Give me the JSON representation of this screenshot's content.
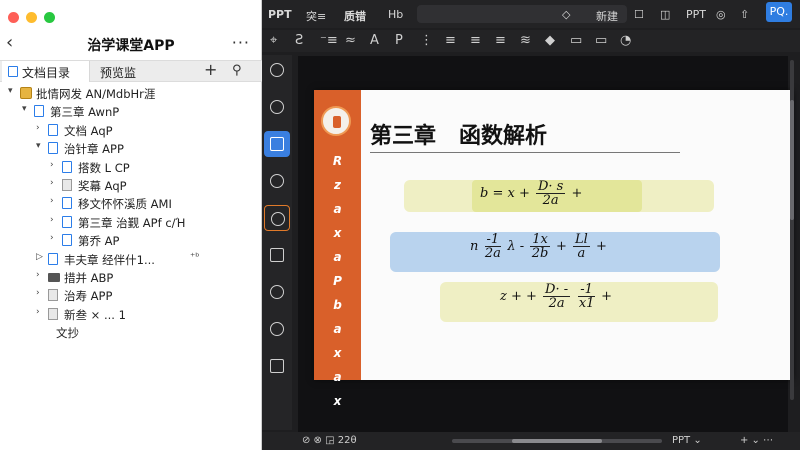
{
  "left_panel": {
    "title": "治学课堂APP",
    "back_icon": "chevron-left-icon",
    "more_label": "···",
    "tabs": [
      {
        "label": "文档目录",
        "icon": "document-icon"
      },
      {
        "label": "预览监"
      }
    ],
    "add_label": "+",
    "tree": [
      {
        "label": "批情网发 AN/MdbHr涯",
        "level": 0,
        "chev": "▾",
        "icon": "root"
      },
      {
        "label": "第三章 AwnP",
        "level": 1,
        "chev": "▾",
        "icon": "doc"
      },
      {
        "label": "文档 AqP",
        "level": 2,
        "chev": "›",
        "icon": "doc"
      },
      {
        "label": "治针章 APP",
        "level": 2,
        "chev": "▾",
        "icon": "doc"
      },
      {
        "label": "搭数 L CP",
        "level": 3,
        "chev": "›",
        "icon": "doc"
      },
      {
        "label": "奖幕 AqP",
        "level": 3,
        "chev": "›",
        "icon": "book"
      },
      {
        "label": "移文怀怀溪质 AMI",
        "level": 3,
        "chev": "›",
        "icon": "doc"
      },
      {
        "label": "第三章  治觐 APf ᴄ/Ή",
        "level": 3,
        "chev": "›",
        "icon": "doc"
      },
      {
        "label": "第乔 AP",
        "level": 3,
        "chev": "›",
        "icon": "doc"
      },
      {
        "label": "丰夫章  经伴什1...",
        "level": 2,
        "chev": "▷",
        "icon": "doc",
        "extra": "⁺ᵇ"
      },
      {
        "label": "措并 ABP",
        "level": 2,
        "chev": "›",
        "icon": "folder"
      },
      {
        "label": "治寿 APP",
        "level": 2,
        "chev": "›",
        "icon": "book"
      },
      {
        "label": "新叁  × ...  1",
        "level": 2,
        "chev": "›",
        "icon": "book"
      },
      {
        "label": "文抄",
        "level": 2,
        "chev": "",
        "icon": "none"
      }
    ]
  },
  "editor": {
    "toolbar1": {
      "app": "PPT",
      "items": [
        "突≡",
        "质错",
        "Hb"
      ],
      "right_items": [
        "◇",
        "新建",
        "☐",
        "◫",
        "PPT",
        "◎",
        "⇧"
      ],
      "account_badge": "PQ."
    },
    "toolbar2": [
      "⌖",
      "Ƨ",
      "⁻≡",
      "≈",
      "A",
      "P",
      "⋮",
      "≡",
      "≡",
      "≡",
      "≋",
      "◆",
      "▭",
      "▭",
      "◔"
    ],
    "rail_icons": [
      {
        "name": "chart-icon",
        "active": false
      },
      {
        "name": "search-icon",
        "active": false
      },
      {
        "name": "search-icon-active",
        "active": true
      },
      {
        "name": "layers-icon",
        "active": false
      },
      {
        "name": "database-icon",
        "active": false,
        "outlined": true
      },
      {
        "name": "clock-icon",
        "active": false
      },
      {
        "name": "comment-icon",
        "active": false
      },
      {
        "name": "screen-icon",
        "active": false
      },
      {
        "name": "grid-icon",
        "active": false
      }
    ],
    "slide": {
      "title": "第三章   函数解析",
      "strip_letters": [
        "R",
        "z",
        "a",
        "x",
        "a",
        "P",
        "b",
        "a",
        "x",
        "a",
        "x"
      ],
      "eq1": {
        "lhs": "b = x +",
        "num": "D· s",
        "den": "2a",
        "tail": "+"
      },
      "eq2": {
        "lhs": "n",
        "f1n": "-1",
        "f1d": "2a",
        "mid": "λ -",
        "f2n": "1x",
        "f2d": "2b",
        "plus": "+",
        "f3n": "Ll",
        "f3d": "a",
        "tail": "+"
      },
      "eq3": {
        "lhs": "z + +",
        "f1n": "D· -",
        "f1d": "2a",
        "f2n": "-1",
        "f2d": "x1",
        "tail": "+"
      },
      "colors": {
        "strip": "#d9602a",
        "band_yellow": "#efefc4",
        "band_blue": "#b9d3ee"
      }
    },
    "status": {
      "left": "⊘  ⊗  ◲  22θ",
      "zoom_menu": "PPT ⌄",
      "right": "+ ⌄  ⋯"
    }
  }
}
